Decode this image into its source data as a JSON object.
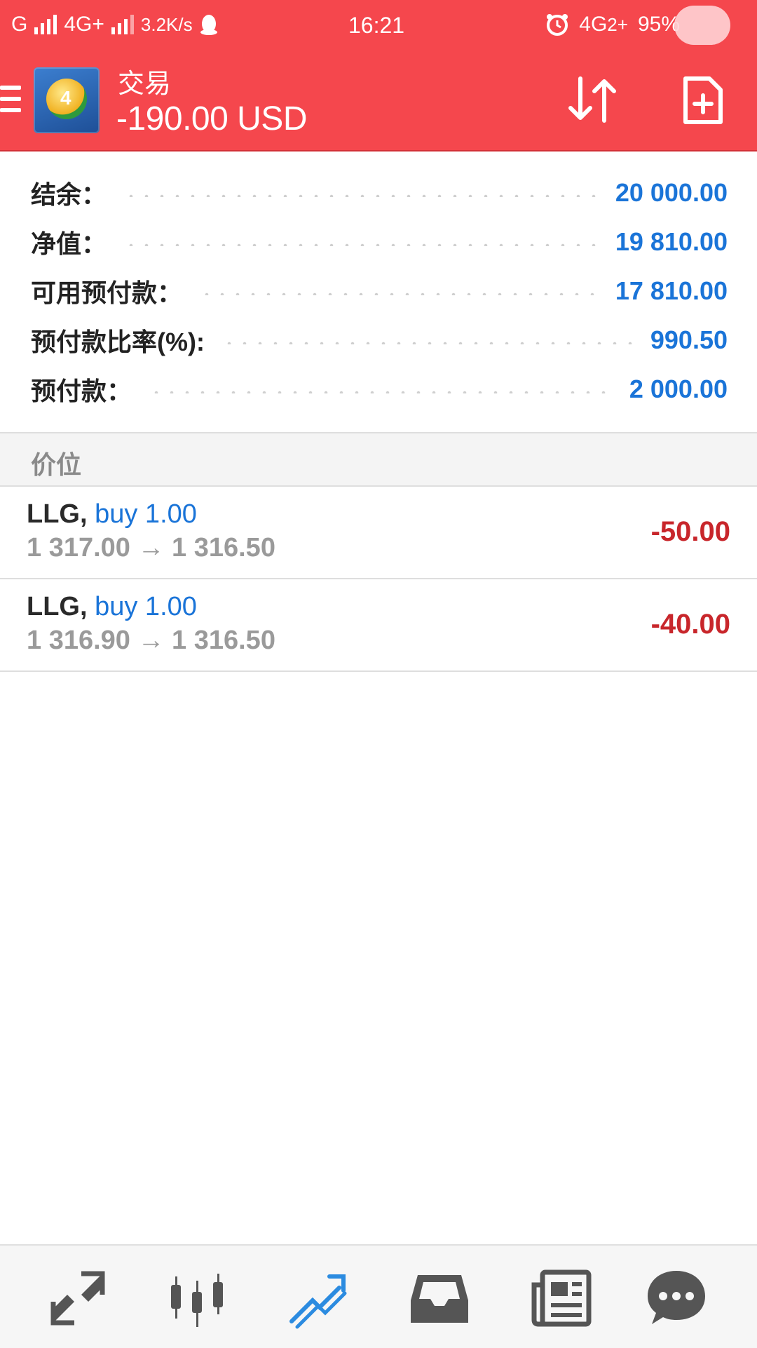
{
  "status_bar": {
    "carrier1": "G",
    "carrier2": "4G+",
    "speed": "3.2K/s",
    "time": "16:21",
    "network_right": "4G",
    "network_right_sub": "2+",
    "battery": "95%"
  },
  "app_bar": {
    "title": "交易",
    "subtitle": "-190.00 USD"
  },
  "summary": [
    {
      "label": "结余：",
      "value": "20 000.00"
    },
    {
      "label": "净值：",
      "value": "19 810.00"
    },
    {
      "label": "可用预付款：",
      "value": "17 810.00"
    },
    {
      "label": "预付款比率(%):",
      "value": "990.50"
    },
    {
      "label": "预付款：",
      "value": "2 000.00"
    }
  ],
  "section": {
    "title": "价位"
  },
  "positions": [
    {
      "symbol": "LLG,",
      "side": "buy 1.00",
      "prices": "1 317.00 → 1 316.50",
      "pl": "-50.00"
    },
    {
      "symbol": "LLG,",
      "side": "buy 1.00",
      "prices": "1 316.90 → 1 316.50",
      "pl": "-40.00"
    }
  ],
  "nav": {
    "items": [
      "quotes-icon",
      "chart-candles-icon",
      "trade-icon",
      "history-inbox-icon",
      "news-icon",
      "chat-icon"
    ],
    "active_color": "#2b8be0",
    "inactive_color": "#555555"
  },
  "colors": {
    "accent": "#f5474d",
    "value_blue": "#1a74d8",
    "loss_red": "#c8262b"
  }
}
